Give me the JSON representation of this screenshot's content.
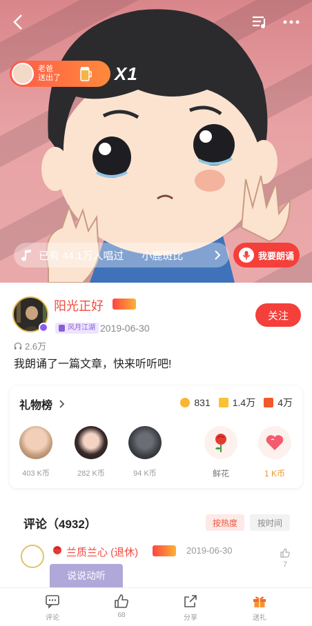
{
  "header": {
    "gift_banner_text": "老爸\n送出了",
    "gift_count": "X1",
    "sing_count": "已有 44.1万人唱过",
    "song_title": "小鹿斑比",
    "sing_button": "我要朗诵"
  },
  "profile": {
    "username": "阳光正好",
    "level_tag": "风月江湖",
    "post_date": "2019-06-30",
    "follow_button": "关注",
    "plays": "2.6万",
    "description": "我朗诵了一篇文章，快来听听吧!"
  },
  "gifts": {
    "title": "礼物榜",
    "stats": {
      "coins": "831",
      "flowers": "1.4万",
      "fires": "4万"
    },
    "gifters": [
      {
        "amount": "403 K币"
      },
      {
        "amount": "282 K币"
      },
      {
        "amount": "94 K币"
      }
    ],
    "give_options": [
      {
        "label": "鲜花"
      },
      {
        "label": "1 K币"
      }
    ]
  },
  "comments": {
    "title": "评论（4932）",
    "sort_hot": "按热度",
    "sort_time": "按时间",
    "first": {
      "name": "兰质兰心 (退休)",
      "date": "2019-06-30",
      "likes": "7",
      "tag": "说说动听"
    }
  },
  "bottom_bar": {
    "comment": "评论",
    "like": "68",
    "share": "分享",
    "gift": "送礼"
  },
  "colors": {
    "accent": "#f43f3b",
    "username": "#f04a3e",
    "gold": "#e8972e"
  }
}
